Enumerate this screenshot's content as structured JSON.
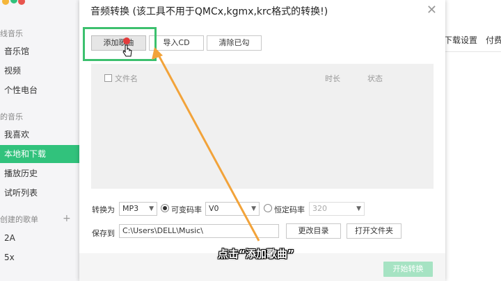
{
  "app": {
    "sidebar": {
      "section_top": "线音乐",
      "top_items": [
        {
          "label": "音乐馆"
        },
        {
          "label": "视频"
        },
        {
          "label": "个性电台"
        }
      ],
      "section_mine": "的音乐",
      "mine_items": [
        {
          "label": "我喜欢"
        },
        {
          "label": "本地和下载",
          "active": true
        },
        {
          "label": "播放历史"
        },
        {
          "label": "试听列表"
        }
      ],
      "section_created": "创建的歌单",
      "plus_label": "+",
      "playlists": [
        {
          "label": "2A"
        },
        {
          "label": "5x"
        }
      ]
    },
    "right_links": [
      "下载设置",
      "付费"
    ]
  },
  "dialog": {
    "title": "音频转换 (该工具不用于QMCx,kgmx,krc格式的转换!)",
    "close_label": "✕",
    "toolbar": {
      "add_song": "添加歌曲",
      "import_cd": "导入CD",
      "clear_checked": "清除已勾"
    },
    "list_header": {
      "filename": "文件名",
      "duration": "时长",
      "status": "状态"
    },
    "convert_to_label": "转换为",
    "format_value": "MP3",
    "vbr_label": "可变码率",
    "vbr_value": "V0",
    "cbr_label": "恒定码率",
    "cbr_value": "320",
    "save_to_label": "保存到",
    "save_path": "C:\\Users\\DELL\\Music\\",
    "change_dir": "更改目录",
    "open_folder": "打开文件夹",
    "start_convert": "开始转换"
  },
  "caption": "点击“添加歌曲”",
  "colors": {
    "accent_green": "#31c27c",
    "highlight_green": "#3cc06e",
    "arrow_orange": "#f2a33a"
  }
}
